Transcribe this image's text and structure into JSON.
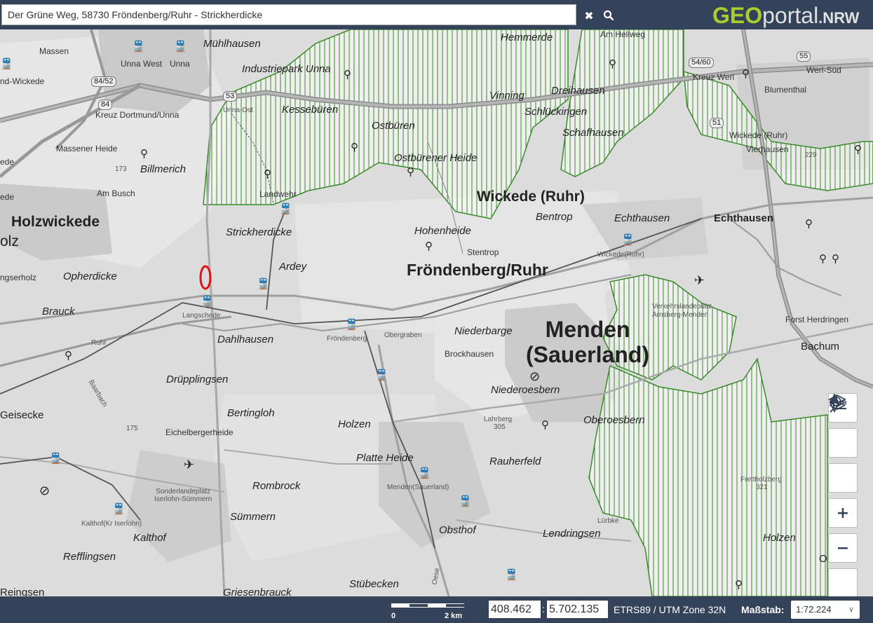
{
  "search": {
    "value": "Der Grüne Weg, 58730 Fröndenberg/Ruhr - Strickherdicke"
  },
  "logo": {
    "part1": "GEO",
    "part2": "portal",
    "part3": ".NRW"
  },
  "toolbar": {
    "clear_icon": "close-icon",
    "search_icon": "search-icon"
  },
  "map_labels": [
    {
      "id": "massen",
      "text": "Massen",
      "cls": "s5"
    },
    {
      "id": "unna-west",
      "text": "Unna West",
      "cls": "s5"
    },
    {
      "id": "unna",
      "text": "Unna",
      "cls": "s5"
    },
    {
      "id": "muehlhausen",
      "text": "Mühlhausen",
      "cls": "s1"
    },
    {
      "id": "hemmerde",
      "text": "Hemmerde",
      "cls": "s1"
    },
    {
      "id": "am-hellweg",
      "text": "Am Hellweg",
      "cls": "s5"
    },
    {
      "id": "industriepark",
      "text": "Industriepark Unna",
      "cls": "s1"
    },
    {
      "id": "nd-wickede",
      "text": "nd-Wickede",
      "cls": "s5"
    },
    {
      "id": "kreuz-dortmund",
      "text": "Kreuz Dortmund/Unna",
      "cls": "s5"
    },
    {
      "id": "unna-ost",
      "text": "Unna-Ost",
      "cls": "s6"
    },
    {
      "id": "kessebueren",
      "text": "Kessebüren",
      "cls": "s1"
    },
    {
      "id": "vinning",
      "text": "Vinning",
      "cls": "s1"
    },
    {
      "id": "dreihausen",
      "text": "Dreihausen",
      "cls": "s1"
    },
    {
      "id": "schlueckingen",
      "text": "Schlückingen",
      "cls": "s1"
    },
    {
      "id": "schafhausen",
      "text": "Schafhausen",
      "cls": "s1"
    },
    {
      "id": "ostbueren",
      "text": "Ostbüren",
      "cls": "s1"
    },
    {
      "id": "kreuz-werl",
      "text": "Kreuz Werl",
      "cls": "s5"
    },
    {
      "id": "werl-sued",
      "text": "Werl-Süd",
      "cls": "s5"
    },
    {
      "id": "blumenthal",
      "text": "Blumenthal",
      "cls": "s5"
    },
    {
      "id": "wickede-ruhr-small",
      "text": "Wickede (Ruhr)",
      "cls": "s5"
    },
    {
      "id": "vierhausen",
      "text": "Vierhausen",
      "cls": "s5"
    },
    {
      "id": "massener-heide",
      "text": "Massener Heide",
      "cls": "s5"
    },
    {
      "id": "billmerich",
      "text": "Billmerich",
      "cls": "s1"
    },
    {
      "id": "am-busch",
      "text": "Am Busch",
      "cls": "s5"
    },
    {
      "id": "ostbuerener-heide",
      "text": "Ostbürener Heide",
      "cls": "s1"
    },
    {
      "id": "landwehr",
      "text": "Landwehr",
      "cls": "s5"
    },
    {
      "id": "wickede-ruhr",
      "text": "Wickede (Ruhr)",
      "cls": "s2"
    },
    {
      "id": "holzwickede",
      "text": "Holzwickede",
      "cls": "s2"
    },
    {
      "id": "bentrop",
      "text": "Bentrop",
      "cls": "s1"
    },
    {
      "id": "echthausen1",
      "text": "Echthausen",
      "cls": "s1"
    },
    {
      "id": "echthausen2",
      "text": "Echthausen",
      "cls": "s1"
    },
    {
      "id": "strickherdicke",
      "text": "Strickherdicke",
      "cls": "s1"
    },
    {
      "id": "hohenheide",
      "text": "Hohenheide",
      "cls": "s1"
    },
    {
      "id": "stentrop",
      "text": "Stentrop",
      "cls": "s5"
    },
    {
      "id": "wickede-station",
      "text": "Wickede(Ruhr)",
      "cls": "s6"
    },
    {
      "id": "ardey",
      "text": "Ardey",
      "cls": "s1"
    },
    {
      "id": "froendenberg-ruhr",
      "text": "Fröndenberg/Ruhr",
      "cls": "s3"
    },
    {
      "id": "opherdicke",
      "text": "Opherdicke",
      "cls": "s1"
    },
    {
      "id": "olz",
      "text": "olz",
      "cls": "s2"
    },
    {
      "id": "ngserholz",
      "text": "ngserholz",
      "cls": "s5"
    },
    {
      "id": "verkehrslandeplatz",
      "text": "Verkehrslandeplatz Arnsberg-Menden",
      "cls": "s6"
    },
    {
      "id": "brauck",
      "text": "Brauck",
      "cls": "s1"
    },
    {
      "id": "langschede",
      "text": "Langschede",
      "cls": "s6"
    },
    {
      "id": "froendenberg",
      "text": "Fröndenberg",
      "cls": "s6"
    },
    {
      "id": "niederbarge",
      "text": "Niederbarge",
      "cls": "s1"
    },
    {
      "id": "forst-herdringen",
      "text": "Forst Herdringen",
      "cls": "s5"
    },
    {
      "id": "dahlhausen",
      "text": "Dahlhausen",
      "cls": "s1"
    },
    {
      "id": "ruhr1",
      "text": "Ruhr",
      "cls": "s6"
    },
    {
      "id": "obergraben",
      "text": "Obergraben",
      "cls": "s6"
    },
    {
      "id": "bachum",
      "text": "Bachum",
      "cls": "s1"
    },
    {
      "id": "brockhausen",
      "text": "Brockhausen",
      "cls": "s5"
    },
    {
      "id": "menden-sauerland",
      "text": "Menden\n(Sauerland)",
      "cls": "s4"
    },
    {
      "id": "druepplingsen",
      "text": "Drüpplingsen",
      "cls": "s1"
    },
    {
      "id": "niederoesbern",
      "text": "Niederoesbern",
      "cls": "s1"
    },
    {
      "id": "baarbach",
      "text": "Baarbach",
      "cls": "s6"
    },
    {
      "id": "geisecke",
      "text": "Geisecke",
      "cls": "s1"
    },
    {
      "id": "bertingloh",
      "text": "Bertingloh",
      "cls": "s1"
    },
    {
      "id": "lahrberg",
      "text": "Lahrberg",
      "cls": "s6"
    },
    {
      "id": "h305",
      "text": "305",
      "cls": "s6"
    },
    {
      "id": "oberoesbern",
      "text": "Oberoesbern",
      "cls": "s1"
    },
    {
      "id": "h175",
      "text": "175",
      "cls": "s6"
    },
    {
      "id": "holzen1",
      "text": "Holzen",
      "cls": "s1"
    },
    {
      "id": "eichelbergerheide",
      "text": "Eichelbergerheide",
      "cls": "s5"
    },
    {
      "id": "platte-heide",
      "text": "Platte Heide",
      "cls": "s1"
    },
    {
      "id": "frettholzberg",
      "text": "Frettholzberg",
      "cls": "s6"
    },
    {
      "id": "h321",
      "text": "321",
      "cls": "s6"
    },
    {
      "id": "sonderlandeplatz",
      "text": "Sonderlandeplatz\nIserlohn-Sümmern",
      "cls": "s6"
    },
    {
      "id": "rombrock",
      "text": "Rombrock",
      "cls": "s1"
    },
    {
      "id": "menden-station",
      "text": "Menden(Sauerland)",
      "cls": "s6"
    },
    {
      "id": "rauherfeld",
      "text": "Rauherfeld",
      "cls": "s1"
    },
    {
      "id": "kalthof-station",
      "text": "Kalthof(Kr Iserlohn)",
      "cls": "s6"
    },
    {
      "id": "suemmern",
      "text": "Sümmern",
      "cls": "s1"
    },
    {
      "id": "luerbke",
      "text": "Lürbke",
      "cls": "s6"
    },
    {
      "id": "kalthof",
      "text": "Kalthof",
      "cls": "s1"
    },
    {
      "id": "obsthof",
      "text": "Obsthof",
      "cls": "s1"
    },
    {
      "id": "lendringsen",
      "text": "Lendringsen",
      "cls": "s1"
    },
    {
      "id": "holzen2",
      "text": "Holzen",
      "cls": "s1"
    },
    {
      "id": "refflingsen",
      "text": "Refflingsen",
      "cls": "s1"
    },
    {
      "id": "oesbern-o",
      "text": "O",
      "cls": "s1"
    },
    {
      "id": "stuebecken",
      "text": "Stübecken",
      "cls": "s1"
    },
    {
      "id": "reingsen",
      "text": "Reingsen",
      "cls": "s1"
    },
    {
      "id": "griesenbrauck",
      "text": "Griesenbrauck",
      "cls": "s1"
    },
    {
      "id": "oese",
      "text": "Oese",
      "cls": "s6"
    },
    {
      "id": "ede",
      "text": "ede",
      "cls": "s5"
    },
    {
      "id": "ede2",
      "text": "ede",
      "cls": "s5"
    },
    {
      "id": "h173",
      "text": "173",
      "cls": "s6"
    },
    {
      "id": "h229",
      "text": "229",
      "cls": "s6"
    }
  ],
  "road_shields": [
    {
      "id": "r84-52",
      "text": "84/52"
    },
    {
      "id": "r84",
      "text": "84"
    },
    {
      "id": "r53",
      "text": "53"
    },
    {
      "id": "r55",
      "text": "55"
    },
    {
      "id": "r54-60",
      "text": "54/60"
    },
    {
      "id": "r51",
      "text": "51"
    }
  ],
  "map_controls": [
    {
      "id": "3d",
      "label": "3D",
      "icon": "3d-view-icon"
    },
    {
      "id": "layers",
      "label": "",
      "icon": "layers-icon"
    },
    {
      "id": "locate",
      "label": "",
      "icon": "locate-icon"
    },
    {
      "id": "zoom-in",
      "label": "+",
      "icon": "zoom-in-icon"
    },
    {
      "id": "zoom-out",
      "label": "−",
      "icon": "zoom-out-icon"
    },
    {
      "id": "north",
      "label": "",
      "icon": "compass-icon"
    }
  ],
  "footer": {
    "scale_start": "0",
    "scale_end": "2 km",
    "coord_x": "408.462",
    "coord_sep": ":",
    "coord_y": "5.702.135",
    "crs": "ETRS89 / UTM Zone 32N",
    "scale_label": "Maßstab:",
    "scale_value": "1:72.224"
  },
  "colors": {
    "header": "#35435a",
    "protected_area": "#3a8a2a",
    "accent": "#a8cf2d",
    "marker": "#e0131b"
  }
}
